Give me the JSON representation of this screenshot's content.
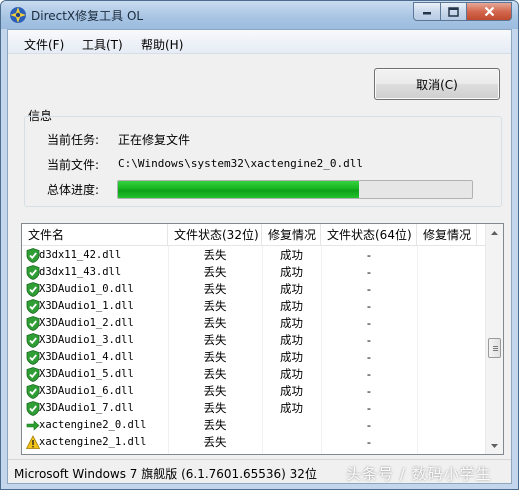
{
  "window": {
    "title": "DirectX修复工具 OL",
    "minimize_glyph": "0",
    "maximize_glyph": "1",
    "close_glyph": "r"
  },
  "menu": [
    "文件(F)",
    "工具(T)",
    "帮助(H)"
  ],
  "cancel_label": "取消(C)",
  "info": {
    "group_title": "信息",
    "task_label": "当前任务:",
    "task_value": "正在修复文件",
    "file_label": "当前文件:",
    "file_value": "C:\\Windows\\system32\\xactengine2_0.dll",
    "progress_label": "总体进度:",
    "progress_fraction": 0.68
  },
  "table": {
    "columns": [
      "文件名",
      "文件状态(32位)",
      "修复情况",
      "文件状态(64位)",
      "修复情况"
    ],
    "rows": [
      {
        "icon": "shield-check-icon",
        "name": "d3dx11_42.dll",
        "s32": "丢失",
        "r32": "成功",
        "s64": "-",
        "r64": ""
      },
      {
        "icon": "shield-check-icon",
        "name": "d3dx11_43.dll",
        "s32": "丢失",
        "r32": "成功",
        "s64": "-",
        "r64": ""
      },
      {
        "icon": "shield-check-icon",
        "name": "X3DAudio1_0.dll",
        "s32": "丢失",
        "r32": "成功",
        "s64": "-",
        "r64": ""
      },
      {
        "icon": "shield-check-icon",
        "name": "X3DAudio1_1.dll",
        "s32": "丢失",
        "r32": "成功",
        "s64": "-",
        "r64": ""
      },
      {
        "icon": "shield-check-icon",
        "name": "X3DAudio1_2.dll",
        "s32": "丢失",
        "r32": "成功",
        "s64": "-",
        "r64": ""
      },
      {
        "icon": "shield-check-icon",
        "name": "X3DAudio1_3.dll",
        "s32": "丢失",
        "r32": "成功",
        "s64": "-",
        "r64": ""
      },
      {
        "icon": "shield-check-icon",
        "name": "X3DAudio1_4.dll",
        "s32": "丢失",
        "r32": "成功",
        "s64": "-",
        "r64": ""
      },
      {
        "icon": "shield-check-icon",
        "name": "X3DAudio1_5.dll",
        "s32": "丢失",
        "r32": "成功",
        "s64": "-",
        "r64": ""
      },
      {
        "icon": "shield-check-icon",
        "name": "X3DAudio1_6.dll",
        "s32": "丢失",
        "r32": "成功",
        "s64": "-",
        "r64": ""
      },
      {
        "icon": "shield-check-icon",
        "name": "X3DAudio1_7.dll",
        "s32": "丢失",
        "r32": "成功",
        "s64": "-",
        "r64": ""
      },
      {
        "icon": "arrow-right-icon",
        "name": "xactengine2_0.dll",
        "s32": "丢失",
        "r32": "",
        "s64": "-",
        "r64": ""
      },
      {
        "icon": "warning-icon",
        "name": "xactengine2_1.dll",
        "s32": "丢失",
        "r32": "",
        "s64": "-",
        "r64": ""
      }
    ]
  },
  "status_text": "Microsoft Windows 7 旗舰版 (6.1.7601.65536) 32位",
  "watermark": "头条号 / 数码小学生",
  "colors": {
    "progress_green": "#16b520",
    "shield_green": "#2e9e35",
    "arrow_green": "#2aa12f",
    "warning_yellow": "#f2c318"
  }
}
